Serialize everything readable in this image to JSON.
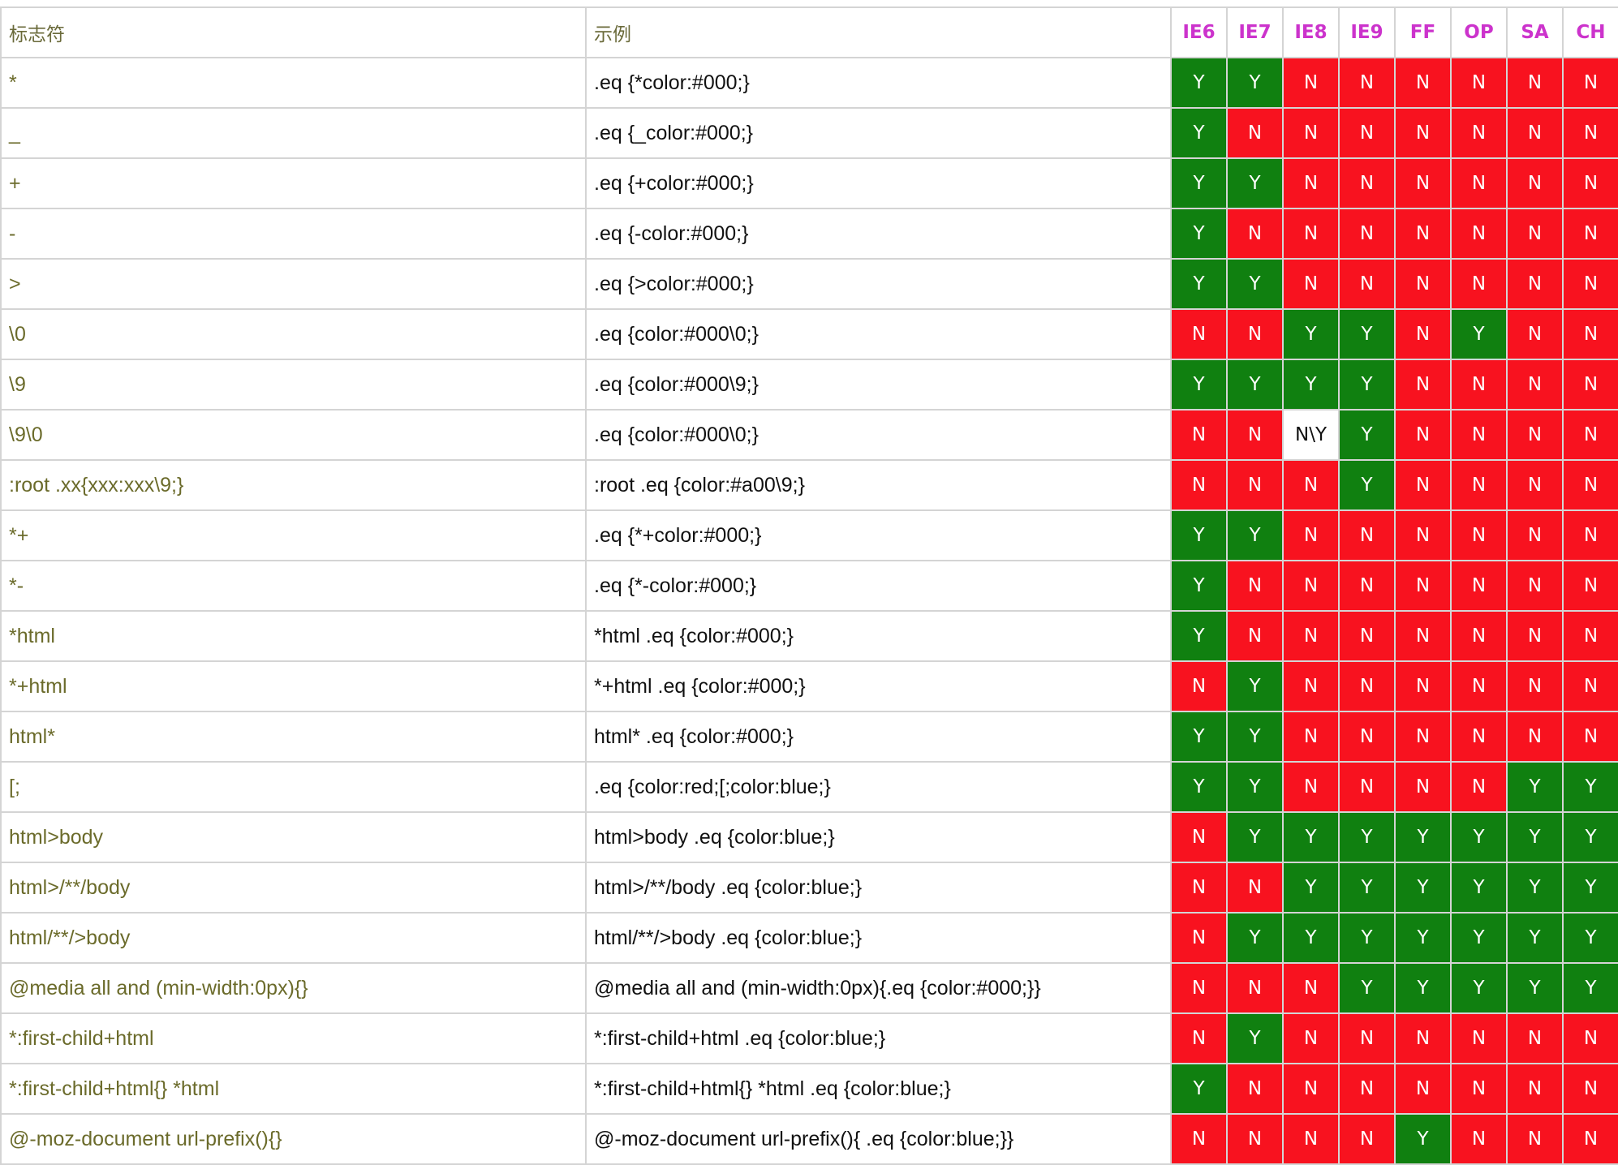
{
  "headers": {
    "flag": "标志符",
    "example": "示例",
    "browsers": [
      "IE6",
      "IE7",
      "IE8",
      "IE9",
      "FF",
      "OP",
      "SA",
      "CH"
    ]
  },
  "colors": {
    "supported": "#108010",
    "unsupported": "#f8121f",
    "mixed": "#ffffff",
    "browser_header": "#cc33cc",
    "flag_text": "#6b6b2b"
  },
  "rows": [
    {
      "flag": "*",
      "example": ".eq {*color:#000;}",
      "support": [
        "Y",
        "Y",
        "N",
        "N",
        "N",
        "N",
        "N",
        "N"
      ]
    },
    {
      "flag": "_",
      "example": ".eq {_color:#000;}",
      "support": [
        "Y",
        "N",
        "N",
        "N",
        "N",
        "N",
        "N",
        "N"
      ]
    },
    {
      "flag": "+",
      "example": ".eq {+color:#000;}",
      "support": [
        "Y",
        "Y",
        "N",
        "N",
        "N",
        "N",
        "N",
        "N"
      ]
    },
    {
      "flag": "-",
      "example": ".eq {-color:#000;}",
      "support": [
        "Y",
        "N",
        "N",
        "N",
        "N",
        "N",
        "N",
        "N"
      ]
    },
    {
      "flag": ">",
      "example": ".eq {>color:#000;}",
      "support": [
        "Y",
        "Y",
        "N",
        "N",
        "N",
        "N",
        "N",
        "N"
      ]
    },
    {
      "flag": "\\0",
      "example": ".eq {color:#000\\0;}",
      "support": [
        "N",
        "N",
        "Y",
        "Y",
        "N",
        "Y",
        "N",
        "N"
      ]
    },
    {
      "flag": "\\9",
      "example": ".eq {color:#000\\9;}",
      "support": [
        "Y",
        "Y",
        "Y",
        "Y",
        "N",
        "N",
        "N",
        "N"
      ]
    },
    {
      "flag": "\\9\\0",
      "example": ".eq {color:#000\\0;}",
      "support": [
        "N",
        "N",
        "N\\Y",
        "Y",
        "N",
        "N",
        "N",
        "N"
      ]
    },
    {
      "flag": ":root .xx{xxx:xxx\\9;}",
      "example": ":root .eq {color:#a00\\9;}",
      "support": [
        "N",
        "N",
        "N",
        "Y",
        "N",
        "N",
        "N",
        "N"
      ]
    },
    {
      "flag": "*+",
      "example": ".eq {*+color:#000;}",
      "support": [
        "Y",
        "Y",
        "N",
        "N",
        "N",
        "N",
        "N",
        "N"
      ]
    },
    {
      "flag": "*-",
      "example": ".eq {*-color:#000;}",
      "support": [
        "Y",
        "N",
        "N",
        "N",
        "N",
        "N",
        "N",
        "N"
      ]
    },
    {
      "flag": "*html",
      "example": "*html .eq {color:#000;}",
      "support": [
        "Y",
        "N",
        "N",
        "N",
        "N",
        "N",
        "N",
        "N"
      ]
    },
    {
      "flag": "*+html",
      "example": "*+html .eq {color:#000;}",
      "support": [
        "N",
        "Y",
        "N",
        "N",
        "N",
        "N",
        "N",
        "N"
      ]
    },
    {
      "flag": "html*",
      "example": "html* .eq {color:#000;}",
      "support": [
        "Y",
        "Y",
        "N",
        "N",
        "N",
        "N",
        "N",
        "N"
      ]
    },
    {
      "flag": "[;",
      "example": ".eq {color:red;[;color:blue;}",
      "support": [
        "Y",
        "Y",
        "N",
        "N",
        "N",
        "N",
        "Y",
        "Y"
      ]
    },
    {
      "flag": "html>body",
      "example": "html>body .eq {color:blue;}",
      "support": [
        "N",
        "Y",
        "Y",
        "Y",
        "Y",
        "Y",
        "Y",
        "Y"
      ]
    },
    {
      "flag": "html>/**/body",
      "example": "html>/**/body .eq {color:blue;}",
      "support": [
        "N",
        "N",
        "Y",
        "Y",
        "Y",
        "Y",
        "Y",
        "Y"
      ]
    },
    {
      "flag": "html/**/>body",
      "example": "html/**/>body .eq {color:blue;}",
      "support": [
        "N",
        "Y",
        "Y",
        "Y",
        "Y",
        "Y",
        "Y",
        "Y"
      ]
    },
    {
      "flag": "@media all and (min-width:0px){}",
      "example": "@media all and (min-width:0px){.eq {color:#000;}}",
      "support": [
        "N",
        "N",
        "N",
        "Y",
        "Y",
        "Y",
        "Y",
        "Y"
      ]
    },
    {
      "flag": "*:first-child+html",
      "example": "*:first-child+html .eq {color:blue;}",
      "support": [
        "N",
        "Y",
        "N",
        "N",
        "N",
        "N",
        "N",
        "N"
      ]
    },
    {
      "flag": "*:first-child+html{} *html",
      "example": "*:first-child+html{} *html .eq {color:blue;}",
      "support": [
        "Y",
        "N",
        "N",
        "N",
        "N",
        "N",
        "N",
        "N"
      ]
    },
    {
      "flag": "@-moz-document url-prefix(){}",
      "example": "@-moz-document url-prefix(){ .eq {color:blue;}}",
      "support": [
        "N",
        "N",
        "N",
        "N",
        "Y",
        "N",
        "N",
        "N"
      ]
    }
  ]
}
